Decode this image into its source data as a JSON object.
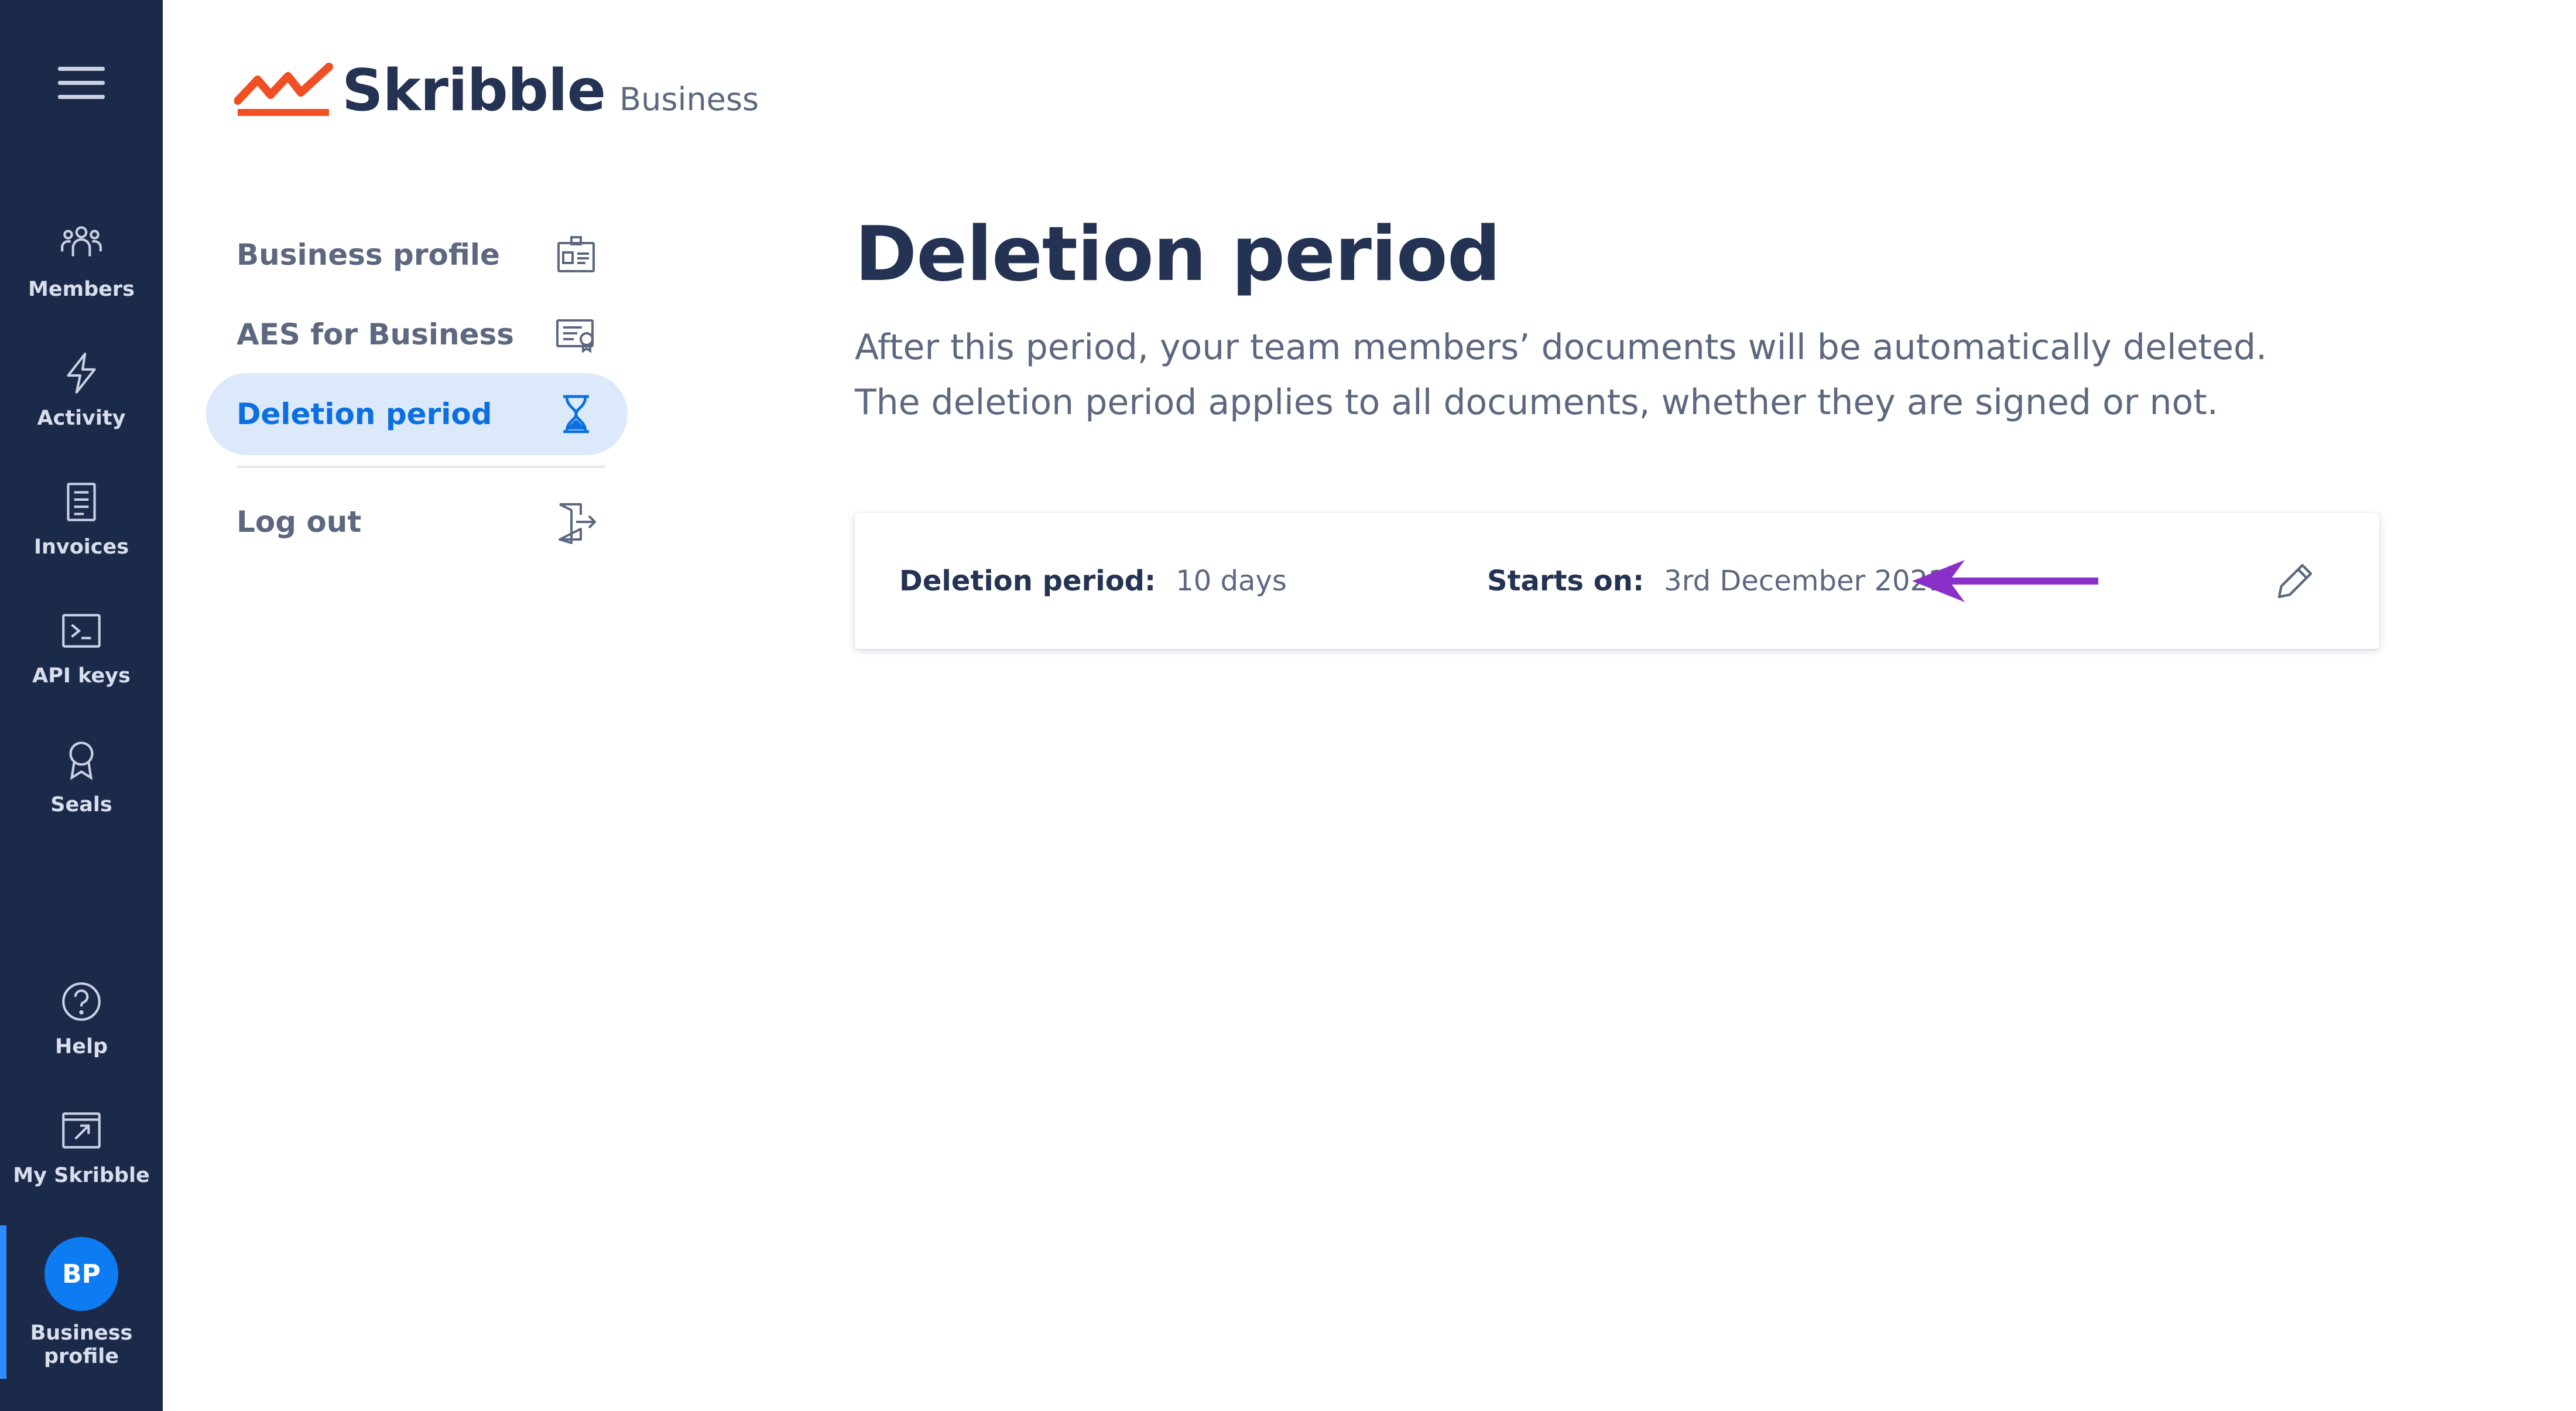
{
  "rail": {
    "items": [
      {
        "label": "Members",
        "icon": "members-icon"
      },
      {
        "label": "Activity",
        "icon": "lightning-icon"
      },
      {
        "label": "Invoices",
        "icon": "invoice-icon"
      },
      {
        "label": "API keys",
        "icon": "terminal-icon"
      },
      {
        "label": "Seals",
        "icon": "seal-icon"
      }
    ],
    "bottom": [
      {
        "label": "Help",
        "icon": "help-icon"
      },
      {
        "label": "My Skribble",
        "icon": "external-link-icon"
      }
    ],
    "profile": {
      "initials": "BP",
      "label": "Business profile"
    }
  },
  "logo": {
    "name": "Skribble",
    "sub": "Business"
  },
  "settings_nav": {
    "items": [
      {
        "label": "Business profile",
        "icon": "id-card-icon"
      },
      {
        "label": "AES for Business",
        "icon": "certificate-icon"
      },
      {
        "label": "Deletion period",
        "icon": "hourglass-icon"
      }
    ],
    "logout": {
      "label": "Log out",
      "icon": "logout-icon"
    },
    "active": "Deletion period"
  },
  "main": {
    "title": "Deletion period",
    "description": "After this period, your team members’ documents will be automatically deleted. The deletion period applies to all documents, whether they are signed or not."
  },
  "card": {
    "period_label": "Deletion period:",
    "period_value": "10 days",
    "start_label": "Starts on:",
    "start_value": "3rd December 2021"
  },
  "colors": {
    "rail_bg": "#1c2a4a",
    "accent_blue": "#0b6fe0",
    "active_bg": "#dbe9fb",
    "logo_orange": "#f04e23",
    "annotation_arrow": "#8a2fc7",
    "heading": "#243353",
    "muted": "#5d6880"
  }
}
